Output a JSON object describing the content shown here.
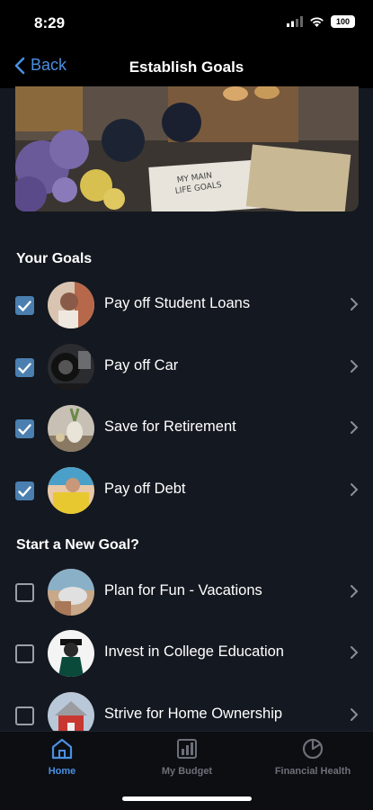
{
  "status_bar": {
    "time": "8:29",
    "battery": "100"
  },
  "nav": {
    "back_label": "Back",
    "title": "Establish Goals"
  },
  "sections": {
    "your_goals": "Your Goals",
    "new_goal": "Start a New Goal?"
  },
  "your_goals": [
    {
      "label": "Pay off Student Loans",
      "checked": true,
      "icon": "student-loans-photo"
    },
    {
      "label": "Pay off Car",
      "checked": true,
      "icon": "car-photo"
    },
    {
      "label": "Save for Retirement",
      "checked": true,
      "icon": "retirement-photo"
    },
    {
      "label": "Pay off Debt",
      "checked": true,
      "icon": "debt-photo"
    }
  ],
  "new_goals": [
    {
      "label": "Plan for Fun - Vacations",
      "checked": false,
      "icon": "vacation-photo"
    },
    {
      "label": "Invest in College Education",
      "checked": false,
      "icon": "graduation-photo"
    },
    {
      "label": "Strive for Home Ownership",
      "checked": false,
      "icon": "house-photo"
    }
  ],
  "tabs": [
    {
      "label": "Home",
      "icon": "home-icon",
      "active": true
    },
    {
      "label": "My Budget",
      "icon": "budget-icon",
      "active": false
    },
    {
      "label": "Financial Health",
      "icon": "pie-chart-icon",
      "active": false
    }
  ],
  "colors": {
    "accent": "#4a90e2",
    "checkbox": "#4a7fb0",
    "background": "#141820"
  }
}
